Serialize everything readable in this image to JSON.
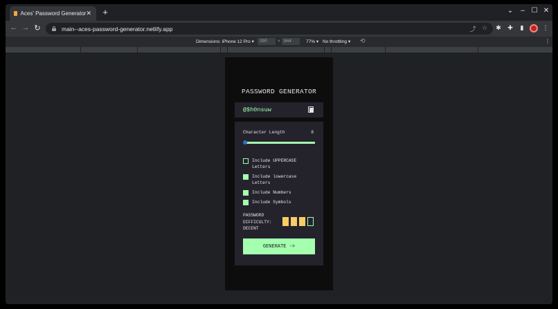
{
  "browser": {
    "tab_title": "Aces' Password Generator",
    "tab_close": "✕",
    "new_tab": "+",
    "url": "main--aces-password-generator.netlify.app",
    "window_controls": {
      "dropdown": "⌄",
      "minimize": "–",
      "maximize": "☐",
      "close": "✕"
    },
    "nav": {
      "back": "←",
      "forward": "→",
      "reload": "↻"
    },
    "toolbar_icons": {
      "share": "⤴",
      "bookmark": "☆",
      "extension": "✱",
      "puzzle": "✚",
      "sidebar": "▮",
      "menu": "⋮"
    }
  },
  "devtools": {
    "dimensions": "Dimensions: iPhone 12 Pro ▾",
    "width": "390",
    "times": "×",
    "height": "844",
    "zoom": "77% ▾",
    "throttling": "No throttling ▾",
    "rotate": "⟲",
    "more": "⋮"
  },
  "app": {
    "title": "PASSWORD GENERATOR",
    "password": "@$h0nsuw",
    "length_label": "Character Length",
    "length_value": "8",
    "length_level": 0,
    "options": [
      {
        "label": "Include UPPERCASE Letters",
        "checked": false
      },
      {
        "label": "Include lowercase Letters",
        "checked": true
      },
      {
        "label": "Include Numbers",
        "checked": true
      },
      {
        "label": "Include Symbols",
        "checked": true
      }
    ],
    "strength_label": "PASSWORD DIFFICULTY: DECENT",
    "strength_bars_filled": 3,
    "strength_bars_total": 4,
    "generate_label": "GENERATE ->"
  },
  "colors": {
    "accent": "#a4ffaf",
    "strength": "#f8cd65",
    "panel": "#24232c",
    "background": "#0d0d0d"
  }
}
